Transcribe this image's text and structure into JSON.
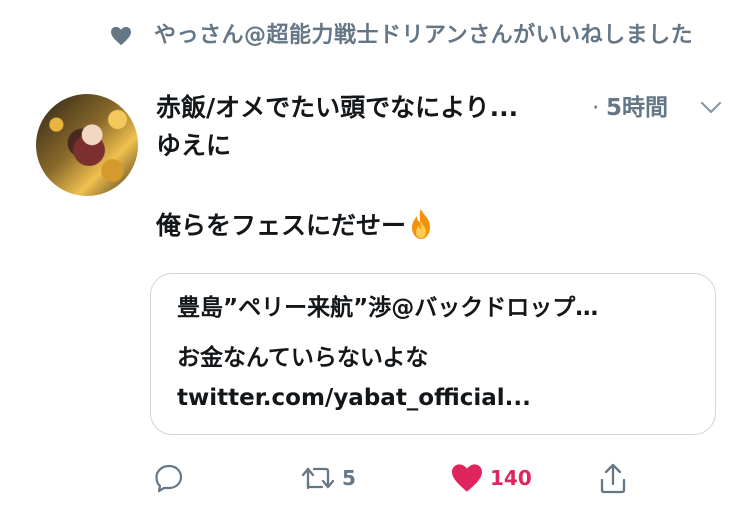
{
  "social_context": {
    "text": "やっさん@超能力戦士ドリアンさんがいいねしました",
    "icon": "heart-icon"
  },
  "tweet": {
    "author_name": "赤飯/オメでたい頭でなにより...",
    "dot": "·",
    "timestamp": "5時間",
    "text_lines": [
      "ゆえに",
      "",
      "俺らをフェスにだせー"
    ],
    "emoji": "fire-icon"
  },
  "quote": {
    "author": "豊島”ペリー来航”渉@バックドロップ…",
    "text": "お金なんていらないよな",
    "link": "twitter.com/yabat_official..."
  },
  "actions": {
    "reply_count": "",
    "retweet_count": "5",
    "like_count": "140",
    "like_active": true
  },
  "colors": {
    "secondary": "#657786",
    "like": "#e0245e",
    "border": "#ccd6dd",
    "text": "#14171a"
  }
}
